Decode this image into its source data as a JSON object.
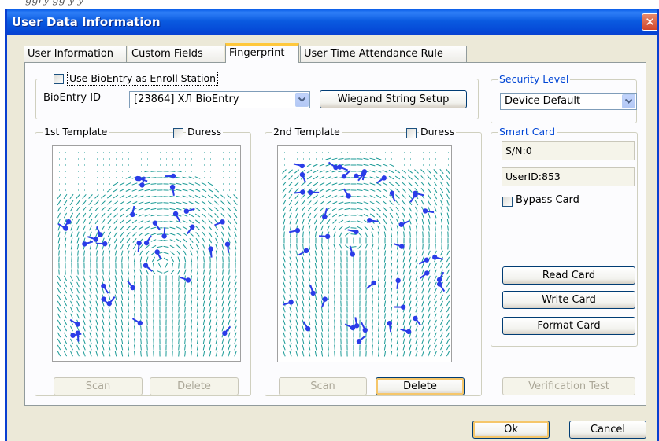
{
  "window": {
    "title": "User Data Information",
    "close_glyph": "✕"
  },
  "tabs": [
    "User Information",
    "Custom Fields",
    "Fingerprint",
    "User Time Attendance Rule"
  ],
  "enroll": {
    "use_bioentry_label": "Use BioEntry as Enroll Station",
    "bioentry_id_label": "BioEntry ID",
    "bioentry_id_value": "[23864] ХЛ BioEntry",
    "wiegand_button": "Wiegand String Setup"
  },
  "template1": {
    "legend": "1st Template",
    "duress_label": "Duress",
    "scan_button": "Scan",
    "delete_button": "Delete"
  },
  "template2": {
    "legend": "2nd Template",
    "duress_label": "Duress",
    "scan_button": "Scan",
    "delete_button": "Delete"
  },
  "security": {
    "legend": "Security Level",
    "value": "Device Default"
  },
  "smart_card": {
    "legend": "Smart Card",
    "serial": "S/N:0",
    "user_id": "UserID:853",
    "bypass_label": "Bypass Card",
    "read_button": "Read Card",
    "write_button": "Write Card",
    "format_button": "Format Card"
  },
  "verification_button": "Verification Test",
  "footer": {
    "ok_button": "Ok",
    "cancel_button": "Cancel"
  },
  "colors": {
    "ridge": "#1a9a96",
    "minutia": "#2a3ce8",
    "title_blue": "#0a5ae0",
    "group_label": "#0046d5"
  },
  "icons": {
    "close": "close-icon",
    "combo_arrow": "chevron-down-icon",
    "minutia": "minutia-marker-icon"
  },
  "top_strip_text": "ggry gg y y"
}
